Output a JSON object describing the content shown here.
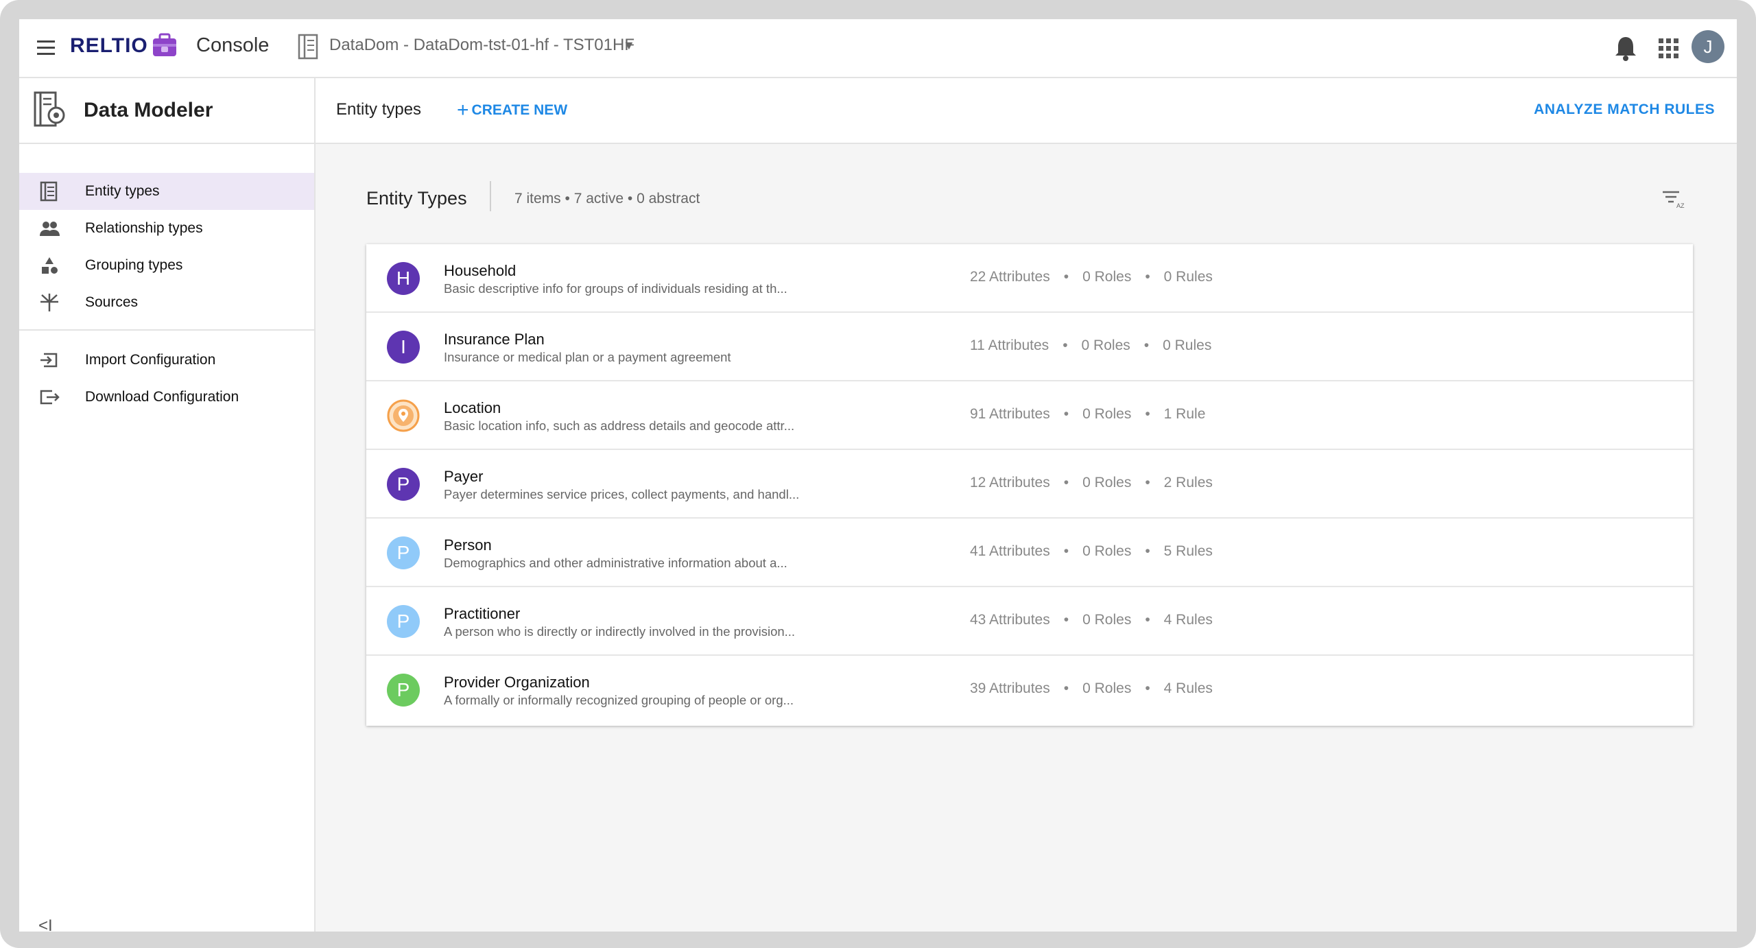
{
  "topbar": {
    "brand": "RELTIO",
    "console_label": "Console",
    "tenant_label": "DataDom - DataDom-tst-01-hf - TST01HF",
    "avatar_initial": "J"
  },
  "sidebar": {
    "title": "Data Modeler",
    "items": [
      {
        "label": "Entity types",
        "icon": "entity-types-icon"
      },
      {
        "label": "Relationship types",
        "icon": "people-icon"
      },
      {
        "label": "Grouping types",
        "icon": "shapes-icon"
      },
      {
        "label": "Sources",
        "icon": "sources-icon"
      }
    ],
    "config_items": [
      {
        "label": "Import Configuration",
        "icon": "import-icon"
      },
      {
        "label": "Download Configuration",
        "icon": "download-icon"
      }
    ],
    "collapse_label": "<I"
  },
  "main": {
    "header_title": "Entity types",
    "create_new_label": "CREATE NEW",
    "analyze_label": "ANALYZE MATCH RULES",
    "list_title": "Entity Types",
    "list_summary": "7 items • 7 active • 0 abstract"
  },
  "entities": [
    {
      "initial": "H",
      "name": "Household",
      "desc": "Basic descriptive info for groups of individuals residing at th...",
      "attributes": "22 Attributes",
      "roles": "0 Roles",
      "rules": "0 Rules",
      "color": "#5e35b1"
    },
    {
      "initial": "I",
      "name": "Insurance Plan",
      "desc": "Insurance or medical plan or a payment agreement",
      "attributes": "11 Attributes",
      "roles": "0 Roles",
      "rules": "0 Rules",
      "color": "#5e35b1"
    },
    {
      "initial": "",
      "name": "Location",
      "desc": "Basic location info, such as address details and geocode attr...",
      "attributes": "91 Attributes",
      "roles": "0 Roles",
      "rules": "1 Rule",
      "color": "#f5a04a",
      "icon": "location-pin-icon"
    },
    {
      "initial": "P",
      "name": "Payer",
      "desc": "Payer determines service prices, collect payments, and handl...",
      "attributes": "12 Attributes",
      "roles": "0 Roles",
      "rules": "2 Rules",
      "color": "#5e35b1"
    },
    {
      "initial": "P",
      "name": "Person",
      "desc": "Demographics and other administrative information about a...",
      "attributes": "41 Attributes",
      "roles": "0 Roles",
      "rules": "5 Rules",
      "color": "#90caf9"
    },
    {
      "initial": "P",
      "name": "Practitioner",
      "desc": "A person who is directly or indirectly involved in the provision...",
      "attributes": "43 Attributes",
      "roles": "0 Roles",
      "rules": "4 Rules",
      "color": "#90caf9"
    },
    {
      "initial": "P",
      "name": "Provider Organization",
      "desc": "A formally or informally recognized grouping of people or org...",
      "attributes": "39 Attributes",
      "roles": "0 Roles",
      "rules": "4 Rules",
      "color": "#6ccb5f"
    }
  ],
  "colors": {
    "accent": "#1e88e5",
    "brand": "#1a1f71",
    "active_nav": "#ede7f6"
  }
}
